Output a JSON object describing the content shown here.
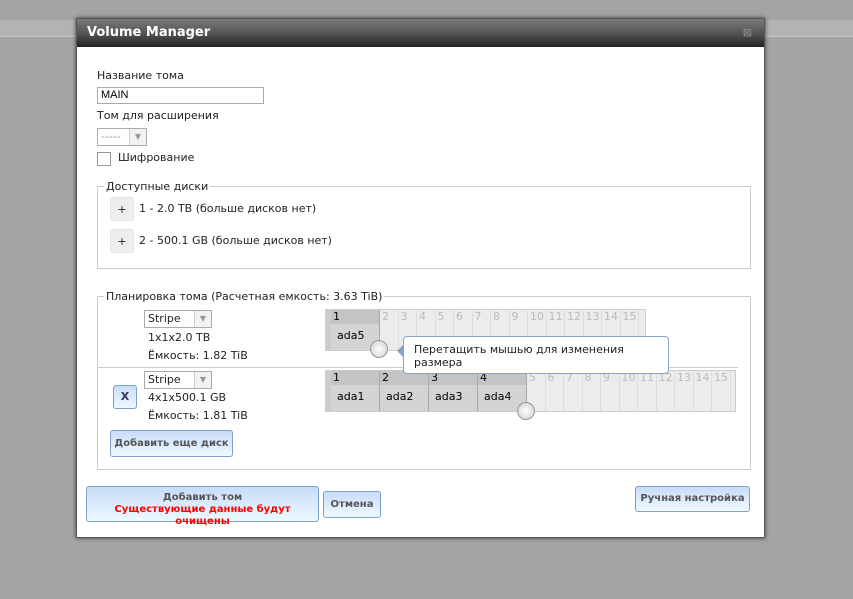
{
  "dialog": {
    "title": "Volume Manager",
    "close": "⊠"
  },
  "volume_name": {
    "label": "Название тома",
    "value": "MAIN"
  },
  "extend": {
    "label": "Том для расширения",
    "value": "-----"
  },
  "encryption": {
    "label": "Шифрование",
    "checked": false
  },
  "available": {
    "legend": "Доступные диски",
    "items": [
      {
        "button": "+",
        "text": "1 - 2.0 TB (больше дисков нет)"
      },
      {
        "button": "+",
        "text": "2 - 500.1 GB (больше дисков нет)"
      }
    ]
  },
  "layout": {
    "legend": "Планировка тома (Расчетная емкость: 3.63 TiB)",
    "groups": [
      {
        "type": "Stripe",
        "config": "1x1x2.0 TB",
        "capacity": "Ёмкость: 1.82 TiB",
        "disks": [
          "ada5"
        ]
      },
      {
        "remove": "X",
        "type": "Stripe",
        "config": "4x1x500.1 GB",
        "capacity": "Ёмкость: 1.81 TiB",
        "disks": [
          "ada1",
          "ada2",
          "ada3",
          "ada4"
        ]
      }
    ],
    "columns": [
      "1",
      "2",
      "3",
      "4",
      "5",
      "6",
      "7",
      "8",
      "9",
      "10",
      "11",
      "12",
      "13",
      "14",
      "15"
    ],
    "add_disk": "Добавить еще диск",
    "tooltip": "Перетащить мышью для изменения размера"
  },
  "buttons": {
    "add_volume": "Добавить том",
    "warning": "Существующие данные будут очищены",
    "cancel": "Отмена",
    "manual": "Ручная настройка"
  },
  "colors": {
    "warning": "#ff0000"
  }
}
